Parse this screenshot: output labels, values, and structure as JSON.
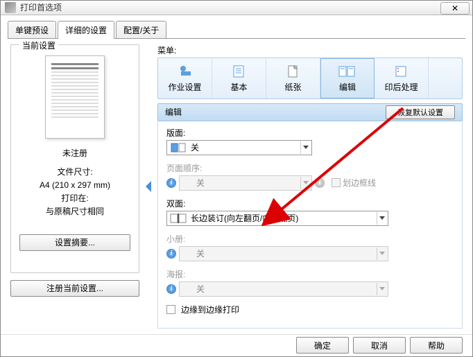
{
  "window": {
    "title": "打印首选项"
  },
  "tabs": [
    {
      "label": "单键预设"
    },
    {
      "label": "详细的设置"
    },
    {
      "label": "配置/关于"
    }
  ],
  "left_panel": {
    "title": "当前设置",
    "unregistered": "未注册",
    "file_size_label": "文件尺寸:",
    "file_size_value": "A4 (210 x 297 mm)",
    "print_at_label": "打印在:",
    "print_at_value": "与原稿尺寸相同",
    "summary_btn": "设置摘要...",
    "register_btn": "注册当前设置..."
  },
  "menu": {
    "label": "菜单:",
    "items": [
      {
        "label": "作业设置"
      },
      {
        "label": "基本"
      },
      {
        "label": "纸张"
      },
      {
        "label": "编辑"
      },
      {
        "label": "印后处理"
      }
    ]
  },
  "section": {
    "title": "编辑",
    "restore_btn": "恢复默认设置"
  },
  "settings": {
    "layout": {
      "label": "版面:",
      "value": "关"
    },
    "page_order": {
      "label": "页面顺序:",
      "value": "关"
    },
    "border": {
      "label": "划边框线"
    },
    "duplex": {
      "label": "双面:",
      "value": "长边装订(向左翻页/向上翻页)"
    },
    "booklet": {
      "label": "小册:",
      "value": "关"
    },
    "poster": {
      "label": "海报:",
      "value": "关"
    },
    "edge_print": {
      "label": "边缘到边缘打印"
    }
  },
  "buttons": {
    "ok": "确定",
    "cancel": "取消",
    "help": "帮助"
  }
}
